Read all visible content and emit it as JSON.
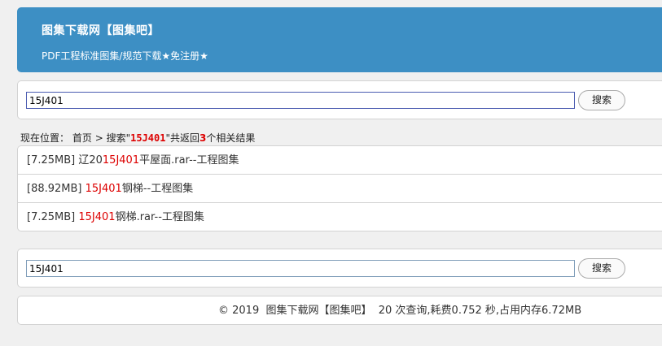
{
  "header": {
    "title": "图集下载网【图集吧】",
    "subtitle": "PDF工程标准图集/规范下载★免注册★"
  },
  "search_top": {
    "value": "15J401",
    "button_label": "搜索"
  },
  "breadcrumb": {
    "prefix": "现在位置：",
    "home": "首页",
    "sep": " > ",
    "search_label": "搜索\"",
    "keyword": "15J401",
    "mid": "\"共返回",
    "count": "3",
    "suffix": "个相关结果"
  },
  "results": [
    {
      "pre": "[7.25MB] 辽20",
      "hl": "15J401",
      "post": "平屋面.rar--工程图集"
    },
    {
      "pre": "[88.92MB] ",
      "hl": "15J401",
      "post": "钢梯--工程图集"
    },
    {
      "pre": "[7.25MB] ",
      "hl": "15J401",
      "post": "钢梯.rar--工程图集"
    }
  ],
  "search_bottom": {
    "value": "15J401",
    "button_label": "搜索"
  },
  "footer": {
    "text": "© 2019  图集下载网【图集吧】  20 次查询,耗费0.752 秒,占用内存6.72MB"
  }
}
